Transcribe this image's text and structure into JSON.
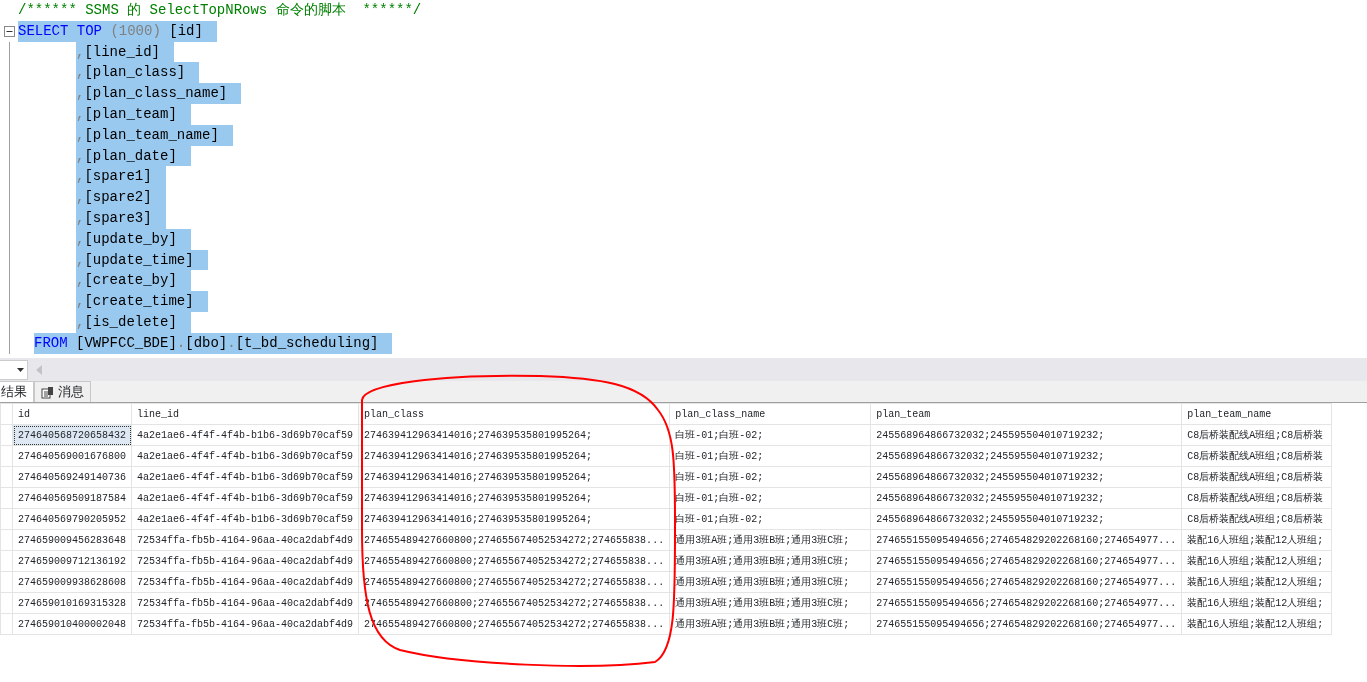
{
  "editor": {
    "lines": [
      {
        "kind": "comment",
        "selected": false,
        "tokens": [
          {
            "kind": "comment",
            "text": "/****** SSMS 的 SelectTopNRows 命令的脚本  ******/"
          }
        ]
      },
      {
        "kind": "select",
        "selected": true,
        "tokens": [
          {
            "kind": "keyword",
            "text": "SELECT TOP"
          },
          {
            "kind": "punct",
            "text": " (1000) "
          },
          {
            "kind": "ident",
            "text": "[id]"
          }
        ]
      },
      {
        "kind": "column",
        "selected": true,
        "tokens": [
          {
            "kind": "punct",
            "text": ","
          },
          {
            "kind": "ident",
            "text": "[line_id]"
          }
        ]
      },
      {
        "kind": "column",
        "selected": true,
        "tokens": [
          {
            "kind": "punct",
            "text": ","
          },
          {
            "kind": "ident",
            "text": "[plan_class]"
          }
        ]
      },
      {
        "kind": "column",
        "selected": true,
        "tokens": [
          {
            "kind": "punct",
            "text": ","
          },
          {
            "kind": "ident",
            "text": "[plan_class_name]"
          }
        ]
      },
      {
        "kind": "column",
        "selected": true,
        "tokens": [
          {
            "kind": "punct",
            "text": ","
          },
          {
            "kind": "ident",
            "text": "[plan_team]"
          }
        ]
      },
      {
        "kind": "column",
        "selected": true,
        "tokens": [
          {
            "kind": "punct",
            "text": ","
          },
          {
            "kind": "ident",
            "text": "[plan_team_name]"
          }
        ]
      },
      {
        "kind": "column",
        "selected": true,
        "tokens": [
          {
            "kind": "punct",
            "text": ","
          },
          {
            "kind": "ident",
            "text": "[plan_date]"
          }
        ]
      },
      {
        "kind": "column",
        "selected": true,
        "tokens": [
          {
            "kind": "punct",
            "text": ","
          },
          {
            "kind": "ident",
            "text": "[spare1]"
          }
        ]
      },
      {
        "kind": "column",
        "selected": true,
        "tokens": [
          {
            "kind": "punct",
            "text": ","
          },
          {
            "kind": "ident",
            "text": "[spare2]"
          }
        ]
      },
      {
        "kind": "column",
        "selected": true,
        "tokens": [
          {
            "kind": "punct",
            "text": ","
          },
          {
            "kind": "ident",
            "text": "[spare3]"
          }
        ]
      },
      {
        "kind": "column",
        "selected": true,
        "tokens": [
          {
            "kind": "punct",
            "text": ","
          },
          {
            "kind": "ident",
            "text": "[update_by]"
          }
        ]
      },
      {
        "kind": "column",
        "selected": true,
        "tokens": [
          {
            "kind": "punct",
            "text": ","
          },
          {
            "kind": "ident",
            "text": "[update_time]"
          }
        ]
      },
      {
        "kind": "column",
        "selected": true,
        "tokens": [
          {
            "kind": "punct",
            "text": ","
          },
          {
            "kind": "ident",
            "text": "[create_by]"
          }
        ]
      },
      {
        "kind": "column",
        "selected": true,
        "tokens": [
          {
            "kind": "punct",
            "text": ","
          },
          {
            "kind": "ident",
            "text": "[create_time]"
          }
        ]
      },
      {
        "kind": "column",
        "selected": true,
        "tokens": [
          {
            "kind": "punct",
            "text": ","
          },
          {
            "kind": "ident",
            "text": "[is_delete]"
          }
        ]
      },
      {
        "kind": "from",
        "selected": true,
        "tokens": [
          {
            "kind": "keyword",
            "text": "FROM"
          },
          {
            "kind": "ident",
            "text": "[VWPFCC_BDE]"
          },
          {
            "kind": "punct",
            "text": "."
          },
          {
            "kind": "ident",
            "text": "[dbo]"
          },
          {
            "kind": "punct",
            "text": "."
          },
          {
            "kind": "ident",
            "text": "[t_bd_scheduling]"
          }
        ]
      }
    ]
  },
  "tabs": [
    {
      "label": "结果",
      "selected": true,
      "kind": "grid"
    },
    {
      "label": "消息",
      "selected": false,
      "kind": "messages"
    }
  ],
  "table": {
    "columns": [
      "id",
      "line_id",
      "plan_class",
      "plan_class_name",
      "plan_team",
      "plan_team_name"
    ],
    "rows": [
      {
        "focused": true,
        "cells": [
          "274640568720658432",
          "4a2e1ae6-4f4f-4f4b-b1b6-3d69b70caf59",
          "274639412963414016;274639535801995264;",
          "白班-01;白班-02;",
          "245568964866732032;245595504010719232;",
          "C8后桥装配线A班组;C8后桥装"
        ]
      },
      {
        "focused": false,
        "cells": [
          "274640569001676800",
          "4a2e1ae6-4f4f-4f4b-b1b6-3d69b70caf59",
          "274639412963414016;274639535801995264;",
          "白班-01;白班-02;",
          "245568964866732032;245595504010719232;",
          "C8后桥装配线A班组;C8后桥装"
        ]
      },
      {
        "focused": false,
        "cells": [
          "274640569249140736",
          "4a2e1ae6-4f4f-4f4b-b1b6-3d69b70caf59",
          "274639412963414016;274639535801995264;",
          "白班-01;白班-02;",
          "245568964866732032;245595504010719232;",
          "C8后桥装配线A班组;C8后桥装"
        ]
      },
      {
        "focused": false,
        "cells": [
          "274640569509187584",
          "4a2e1ae6-4f4f-4f4b-b1b6-3d69b70caf59",
          "274639412963414016;274639535801995264;",
          "白班-01;白班-02;",
          "245568964866732032;245595504010719232;",
          "C8后桥装配线A班组;C8后桥装"
        ]
      },
      {
        "focused": false,
        "cells": [
          "274640569790205952",
          "4a2e1ae6-4f4f-4f4b-b1b6-3d69b70caf59",
          "274639412963414016;274639535801995264;",
          "白班-01;白班-02;",
          "245568964866732032;245595504010719232;",
          "C8后桥装配线A班组;C8后桥装"
        ]
      },
      {
        "focused": false,
        "cells": [
          "274659009456283648",
          "72534ffa-fb5b-4164-96aa-40ca2dabf4d9",
          "274655489427660800;274655674052534272;274655838...",
          "通用3班A班;通用3班B班;通用3班C班;",
          "274655155095494656;274654829202268160;274654977...",
          "装配16人班组;装配12人班组;"
        ]
      },
      {
        "focused": false,
        "cells": [
          "274659009712136192",
          "72534ffa-fb5b-4164-96aa-40ca2dabf4d9",
          "274655489427660800;274655674052534272;274655838...",
          "通用3班A班;通用3班B班;通用3班C班;",
          "274655155095494656;274654829202268160;274654977...",
          "装配16人班组;装配12人班组;"
        ]
      },
      {
        "focused": false,
        "cells": [
          "274659009938628608",
          "72534ffa-fb5b-4164-96aa-40ca2dabf4d9",
          "274655489427660800;274655674052534272;274655838...",
          "通用3班A班;通用3班B班;通用3班C班;",
          "274655155095494656;274654829202268160;274654977...",
          "装配16人班组;装配12人班组;"
        ]
      },
      {
        "focused": false,
        "cells": [
          "274659010169315328",
          "72534ffa-fb5b-4164-96aa-40ca2dabf4d9",
          "274655489427660800;274655674052534272;274655838...",
          "通用3班A班;通用3班B班;通用3班C班;",
          "274655155095494656;274654829202268160;274654977...",
          "装配16人班组;装配12人班组;"
        ]
      },
      {
        "focused": false,
        "cells": [
          "274659010400002048",
          "72534ffa-fb5b-4164-96aa-40ca2dabf4d9",
          "274655489427660800;274655674052534272;274655838...",
          "通用3班A班;通用3班B班;通用3班C班;",
          "274655155095494656;274654829202268160;274654977...",
          "装配16人班组;装配12人班组;"
        ]
      }
    ]
  }
}
